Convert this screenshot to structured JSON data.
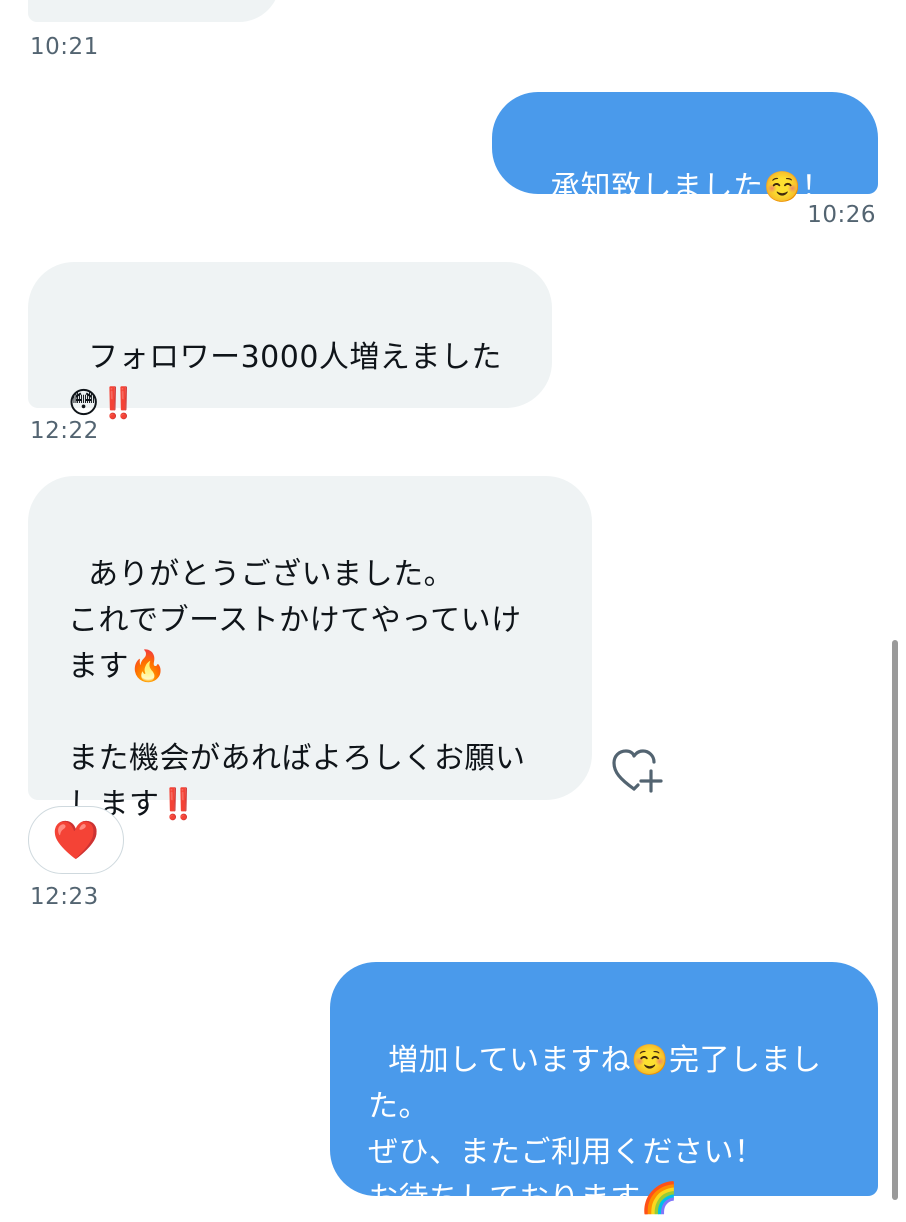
{
  "messages": [
    {
      "direction": "incoming",
      "text": "",
      "time": "10:21"
    },
    {
      "direction": "outgoing",
      "text": "承知致しました☺️！",
      "time": "10:26"
    },
    {
      "direction": "incoming",
      "text": "フォロワー3000人増えました\n😳‼️",
      "time": "12:22"
    },
    {
      "direction": "incoming",
      "text": "ありがとうございました。\nこれでブーストかけてやっていけ\nます🔥\n\nまた機会があればよろしくお願い\nします‼️",
      "time": "12:23",
      "reaction": "❤️"
    },
    {
      "direction": "outgoing",
      "text": "増加していますね☺️完了しまし\nた。\nぜひ、またご利用ください！\nお待ちしております🌈",
      "time": ""
    }
  ],
  "icons": {
    "add_reaction": "heart-plus-icon"
  },
  "colors": {
    "outgoing_bubble": "#4a9aeb",
    "incoming_bubble": "#eff3f4",
    "timestamp": "#536471"
  }
}
